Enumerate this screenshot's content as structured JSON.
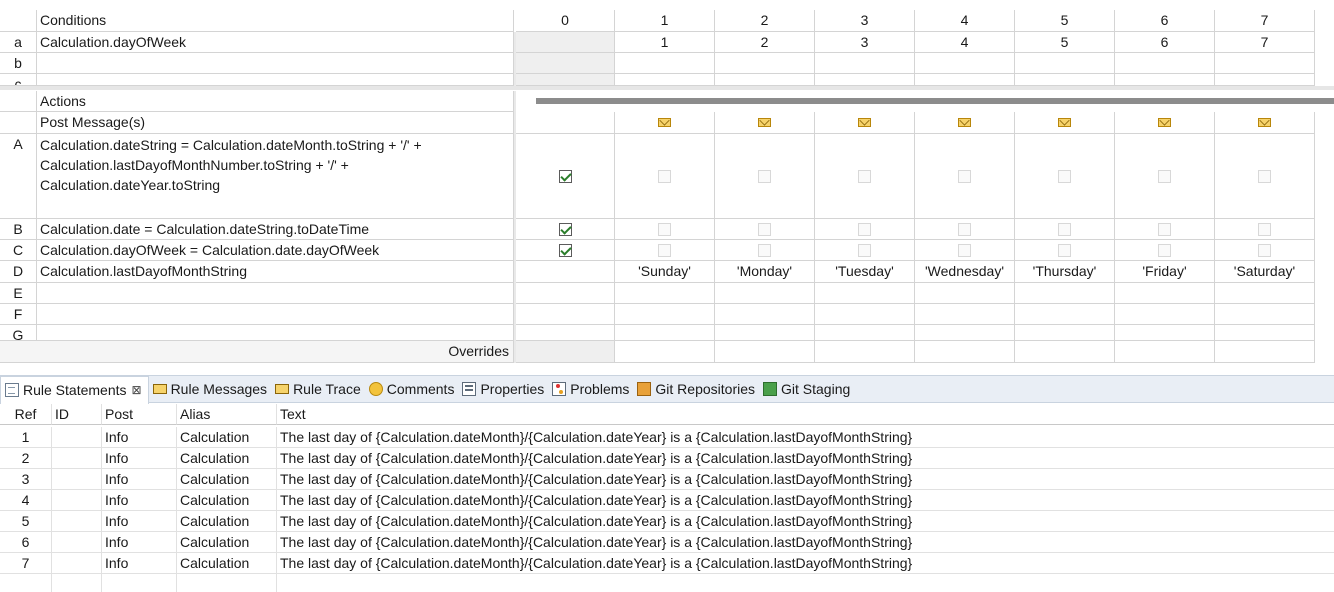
{
  "columns": [
    "0",
    "1",
    "2",
    "3",
    "4",
    "5",
    "6",
    "7"
  ],
  "conditions": {
    "header": "Conditions",
    "rows": [
      {
        "letter": "a",
        "expr": "Calculation.dayOfWeek",
        "values": [
          "",
          "1",
          "2",
          "3",
          "4",
          "5",
          "6",
          "7"
        ]
      },
      {
        "letter": "b",
        "expr": "",
        "values": [
          "",
          "",
          "",
          "",
          "",
          "",
          "",
          ""
        ]
      },
      {
        "letter": "c",
        "expr": "",
        "values": [
          "",
          "",
          "",
          "",
          "",
          "",
          "",
          ""
        ]
      }
    ]
  },
  "actions": {
    "header": "Actions",
    "post_message_label": "Post Message(s)",
    "rows": [
      {
        "letter": "A",
        "expr": "Calculation.dateString = Calculation.dateMonth.toString + '/' + Calculation.lastDayofMonthNumber.toString + '/' + Calculation.dateYear.toString"
      },
      {
        "letter": "B",
        "expr": "Calculation.date = Calculation.dateString.toDateTime"
      },
      {
        "letter": "C",
        "expr": "Calculation.dayOfWeek = Calculation.date.dayOfWeek"
      },
      {
        "letter": "D",
        "expr": "Calculation.lastDayofMonthString",
        "values": [
          "",
          "'Sunday'",
          "'Monday'",
          "'Tuesday'",
          "'Wednesday'",
          "'Thursday'",
          "'Friday'",
          "'Saturday'"
        ]
      },
      {
        "letter": "E",
        "expr": ""
      },
      {
        "letter": "F",
        "expr": ""
      },
      {
        "letter": "G",
        "expr": ""
      }
    ],
    "overrides_label": "Overrides"
  },
  "tabs": [
    {
      "label": "Rule Statements",
      "icon": "document-icon",
      "active": true
    },
    {
      "label": "Rule Messages",
      "icon": "mail-icon"
    },
    {
      "label": "Rule Trace",
      "icon": "mail-icon"
    },
    {
      "label": "Comments",
      "icon": "comment-icon"
    },
    {
      "label": "Properties",
      "icon": "properties-icon"
    },
    {
      "label": "Problems",
      "icon": "problems-icon"
    },
    {
      "label": "Git Repositories",
      "icon": "git-repositories-icon"
    },
    {
      "label": "Git Staging",
      "icon": "git-staging-icon"
    }
  ],
  "tab_close_glyph": "⊠",
  "rule_statements": {
    "headers": {
      "ref": "Ref",
      "id": "ID",
      "post": "Post",
      "alias": "Alias",
      "text": "Text"
    },
    "rows": [
      {
        "ref": "1",
        "id": "",
        "post": "Info",
        "alias": "Calculation",
        "text": "The last day of {Calculation.dateMonth}/{Calculation.dateYear} is a {Calculation.lastDayofMonthString}"
      },
      {
        "ref": "2",
        "id": "",
        "post": "Info",
        "alias": "Calculation",
        "text": "The last day of {Calculation.dateMonth}/{Calculation.dateYear} is a {Calculation.lastDayofMonthString}"
      },
      {
        "ref": "3",
        "id": "",
        "post": "Info",
        "alias": "Calculation",
        "text": "The last day of {Calculation.dateMonth}/{Calculation.dateYear} is a {Calculation.lastDayofMonthString}"
      },
      {
        "ref": "4",
        "id": "",
        "post": "Info",
        "alias": "Calculation",
        "text": "The last day of {Calculation.dateMonth}/{Calculation.dateYear} is a {Calculation.lastDayofMonthString}"
      },
      {
        "ref": "5",
        "id": "",
        "post": "Info",
        "alias": "Calculation",
        "text": "The last day of {Calculation.dateMonth}/{Calculation.dateYear} is a {Calculation.lastDayofMonthString}"
      },
      {
        "ref": "6",
        "id": "",
        "post": "Info",
        "alias": "Calculation",
        "text": "The last day of {Calculation.dateMonth}/{Calculation.dateYear} is a {Calculation.lastDayofMonthString}"
      },
      {
        "ref": "7",
        "id": "",
        "post": "Info",
        "alias": "Calculation",
        "text": "The last day of {Calculation.dateMonth}/{Calculation.dateYear} is a {Calculation.lastDayofMonthString}"
      }
    ]
  }
}
